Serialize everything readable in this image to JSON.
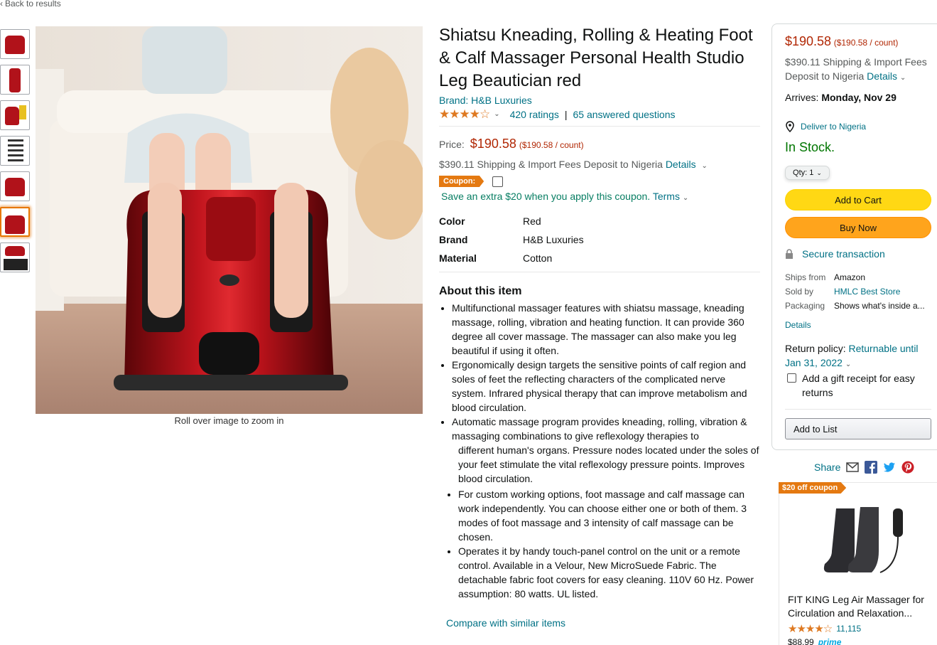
{
  "nav": {
    "back_label": "Back to results"
  },
  "gallery": {
    "zoom_hint": "Roll over image to zoom in",
    "thumb_count": 7,
    "selected_index": 5
  },
  "product": {
    "title": "Shiatsu Kneading, Rolling & Heating Foot & Calf Massager Personal Health Studio Leg Beautician red",
    "brand_link": "Brand: H&B Luxuries",
    "stars": "★★★★☆",
    "rating_value": 4.2,
    "ratings_label": "420 ratings",
    "answers_label": "65 answered questions",
    "price_label": "Price:",
    "price": "$190.58",
    "unit_price": "($190.58 / count)",
    "shipping": "$390.11 Shipping & Import Fees Deposit to Nigeria",
    "details_link": "Details",
    "coupon_badge": "Coupon:",
    "coupon_text": "Save an extra $20 when you apply this coupon.",
    "terms_link": "Terms",
    "specs": [
      {
        "key": "Color",
        "value": "Red"
      },
      {
        "key": "Brand",
        "value": "H&B Luxuries"
      },
      {
        "key": "Material",
        "value": "Cotton"
      }
    ],
    "about_title": "About this item",
    "bullets": [
      "Multifunctional massager features with shiatsu massage, kneading massage, rolling, vibration and heating function. It can provide 360 degree all cover massage. The massager can also make you leg beautiful if using it often.",
      "Ergonomically design targets the sensitive points of calf region and soles of feet the reflecting characters of the complicated nerve system. Infrared physical therapy that can improve metabolism and blood circulation.",
      "Automatic massage program provides kneading, rolling, vibration & massaging combinations to give reflexology therapies to"
    ],
    "bullet_continuation": "different human's organs. Pressure nodes located under the soles of your feet stimulate the vital reflexology pressure points. Improves blood circulation.",
    "bullets_indented": [
      "For custom working options, foot massage and calf massage can work independently. You can choose either one or both of them. 3 modes of foot massage and 3 intensity of calf massage can be chosen.",
      "Operates it by handy touch-panel control on the unit or a remote control. Available in a Velour, New MicroSuede Fabric. The detachable fabric foot covers for easy cleaning. 110V 60 Hz. Power assumption: 80 watts. UL listed."
    ],
    "compare_link": "Compare with similar items"
  },
  "buybox": {
    "price": "$190.58",
    "unit_price": "($190.58 / count)",
    "shipping_line1": "$390.11 Shipping & Import Fees",
    "shipping_line2": "Deposit to Nigeria",
    "details_link": "Details",
    "arrives_label": "Arrives:",
    "arrives_date": "Monday, Nov 29",
    "deliver_link": "Deliver to Nigeria",
    "stock": "In Stock.",
    "qty_label": "Qty: 1",
    "add_to_cart": "Add to Cart",
    "buy_now": "Buy Now",
    "secure": "Secure transaction",
    "ships_from_label": "Ships from",
    "ships_from": "Amazon",
    "sold_by_label": "Sold by",
    "sold_by": "HMLC Best Store",
    "packaging_label": "Packaging",
    "packaging": "Shows what's inside a...",
    "details2": "Details",
    "return_label": "Return policy:",
    "return_link": "Returnable until Jan 31, 2022",
    "gift_label": "Add a gift receipt for easy returns",
    "add_to_list": "Add to List"
  },
  "share": {
    "label": "Share"
  },
  "ad": {
    "badge": "$20 off coupon",
    "title": "FIT KING Leg Air Massager for Circulation and Relaxation...",
    "stars": "★★★★☆",
    "rating_value": 4.5,
    "reviews": "11,115",
    "price": "$88.99",
    "prime": "prime"
  },
  "colors": {
    "link": "#007185",
    "price": "#b12704",
    "stock": "#007600",
    "cart": "#ffd814",
    "buy": "#ffa41c",
    "coupon": "#e47911"
  }
}
